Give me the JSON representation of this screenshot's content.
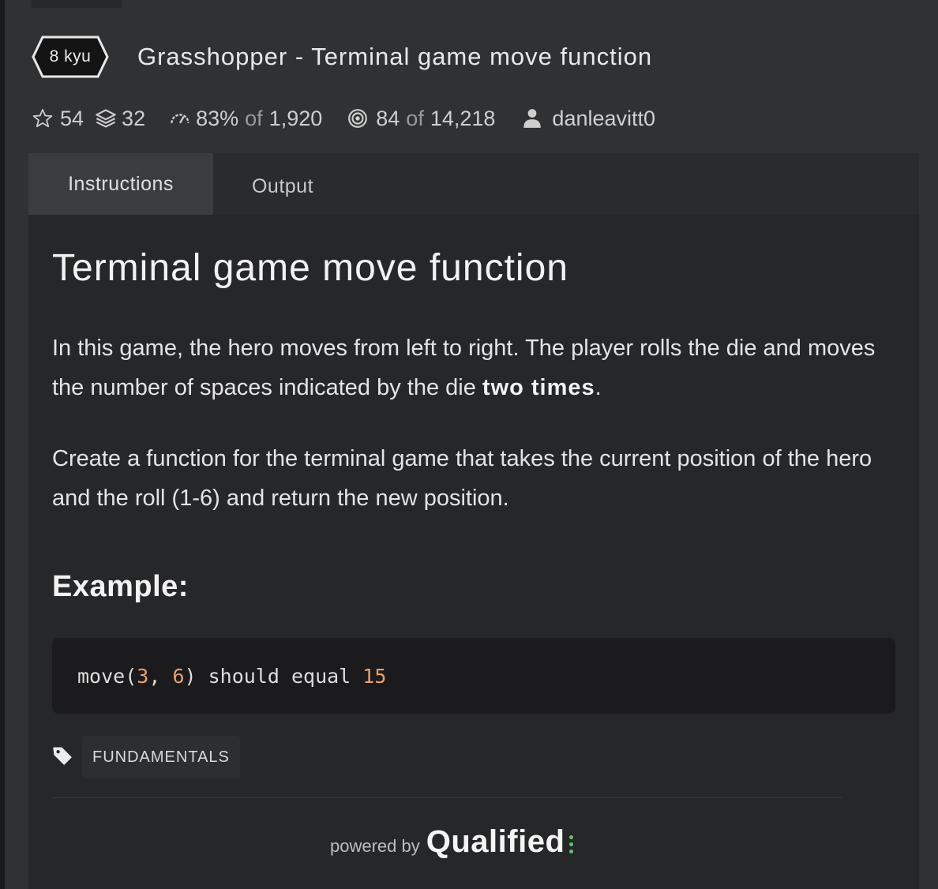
{
  "header": {
    "rank": "8 kyu",
    "title": "Grasshopper - Terminal game move function"
  },
  "stats": {
    "stars": "54",
    "collections": "32",
    "satisfaction": "83%",
    "satisfaction_of": "of",
    "satisfaction_total": "1,920",
    "completed": "84",
    "completed_of": "of",
    "completed_total": "14,218",
    "author": "danleavitt0"
  },
  "tabs": [
    {
      "label": "Instructions",
      "active": true
    },
    {
      "label": "Output",
      "active": false
    }
  ],
  "content": {
    "heading": "Terminal game move function",
    "para1_text": "In this game, the hero moves from left to right. The player rolls the die and moves the number of spaces indicated by the die ",
    "para1_bold": "two times",
    "para1_end": ".",
    "para2": "Create a function for the terminal game that takes the current position of the hero and the roll (1-6) and return the new position.",
    "example_heading": "Example:",
    "code": {
      "fn": "move(",
      "arg1": "3",
      "sep": ", ",
      "arg2": "6",
      "rest": ") should equal ",
      "result": "15"
    }
  },
  "tags": [
    "FUNDAMENTALS"
  ],
  "footer": {
    "powered_by": "powered by",
    "brand": "Qualified"
  },
  "colors": {
    "page_bg": "#303133",
    "panel_bg": "#262729",
    "code_bg": "#1b1b1d",
    "number_accent": "#e8a070",
    "brand_dots": "#6cc06a"
  }
}
